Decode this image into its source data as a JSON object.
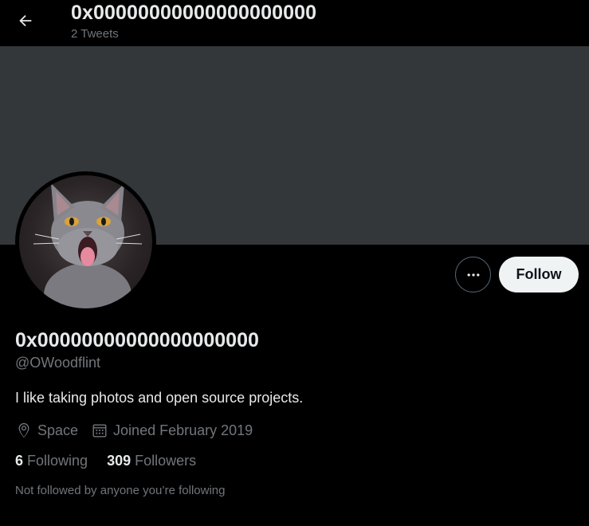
{
  "header": {
    "title": "0x00000000000000000000",
    "subtitle": "2 Tweets",
    "back_icon": "arrow-left-icon"
  },
  "profile": {
    "display_name": "0x00000000000000000000",
    "handle": "@OWoodflint",
    "bio": "I like taking photos and open source projects.",
    "location": "Space",
    "joined": "Joined February 2019",
    "following_count": "6",
    "following_label": "Following",
    "followers_count": "309",
    "followers_label": "Followers",
    "note": "Not followed by anyone you’re following"
  },
  "actions": {
    "follow_label": "Follow",
    "more_icon": "more-options-icon"
  },
  "colors": {
    "background": "#000000",
    "banner": "#33373a",
    "primary_text": "#e7e9ea",
    "secondary_text": "#71767b",
    "follow_button_bg": "#eff3f4"
  }
}
